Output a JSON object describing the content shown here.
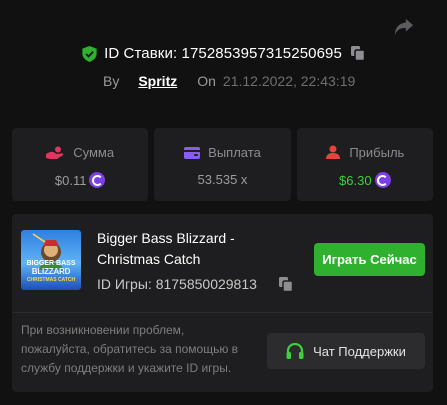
{
  "header": {
    "bet_id_label": "ID Ставки:",
    "bet_id": "1752853957315250695",
    "by_label": "By",
    "username": "Spritz",
    "on_label": "On",
    "datetime": "21.12.2022, 22:43:19"
  },
  "stats": {
    "amount": {
      "label": "Сумма",
      "value": "$0.11"
    },
    "payout": {
      "label": "Выплата",
      "value": "53.535 x"
    },
    "profit": {
      "label": "Прибыль",
      "value": "$6.30"
    }
  },
  "game": {
    "title": "Bigger Bass Blizzard - Christmas Catch",
    "thumb_line1": "BIGGER BASS",
    "thumb_line2": "BLIZZARD",
    "thumb_line3": "CHRISTMAS CATCH",
    "id_label": "ID Игры:",
    "id": "8175850029813",
    "play_label": "Играть Сейчас"
  },
  "help": {
    "text": "При возникновении проблем, пожалуйста, обратитесь за помощью в службу поддержки и укажите ID игры.",
    "support_label": "Чат Поддержки"
  },
  "colors": {
    "background": "#111112",
    "card": "#1e1e20",
    "accent_green": "#2fb02f",
    "profit_green": "#3ecf3e",
    "coin_purple": "#7b3fe4",
    "amount_pink": "#e0355f",
    "payout_purple": "#8a5cf6",
    "profit_red": "#e3443c"
  },
  "icons": {
    "share": "share-icon",
    "verified": "shield-check-icon",
    "copy": "copy-icon",
    "amount": "hand-coin-icon",
    "payout": "wallet-icon",
    "profit": "profit-user-icon",
    "currency": "coin-icon",
    "support": "headset-icon"
  }
}
